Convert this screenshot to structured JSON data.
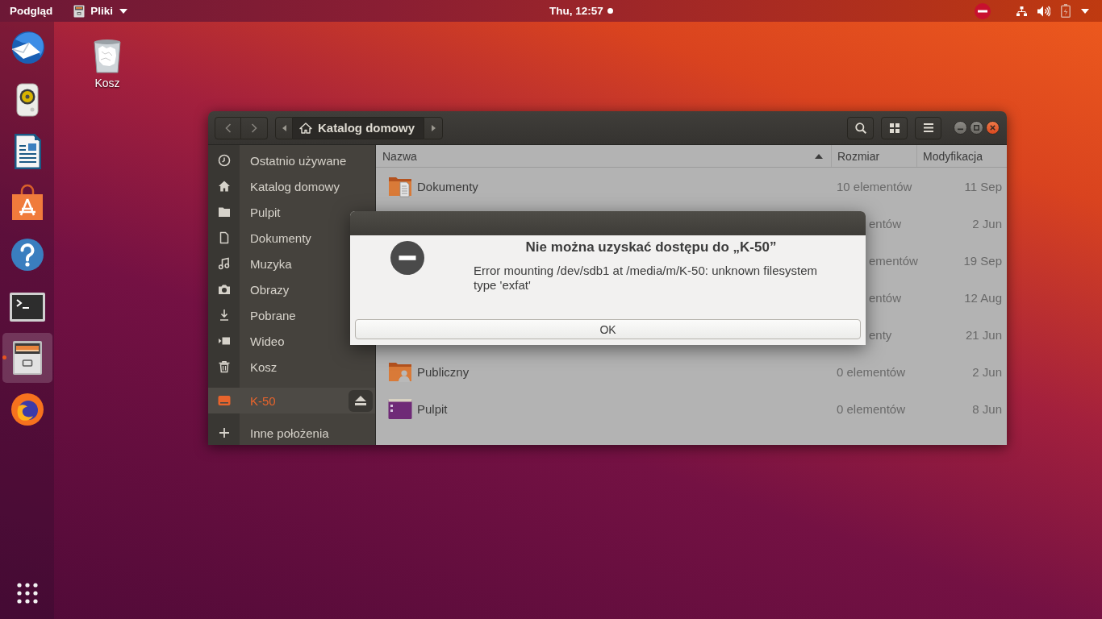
{
  "top_bar": {
    "activities": "Podgląd",
    "app_menu": "Pliki",
    "clock": "Thu, 12:57",
    "unread_notifications": true
  },
  "dock": {
    "items": [
      {
        "kind": "mail",
        "selected": false,
        "running": false
      },
      {
        "kind": "music",
        "selected": false,
        "running": false
      },
      {
        "kind": "writer",
        "selected": false,
        "running": false
      },
      {
        "kind": "software",
        "selected": false,
        "running": false
      },
      {
        "kind": "help",
        "selected": false,
        "running": false
      },
      {
        "kind": "terminal",
        "selected": false,
        "running": false
      },
      {
        "kind": "files",
        "selected": true,
        "running": true
      },
      {
        "kind": "browser",
        "selected": false,
        "running": false
      }
    ]
  },
  "desktop_icons": [
    {
      "kind": "trash",
      "label": "Kosz"
    }
  ],
  "file_manager": {
    "nav": {
      "back": {
        "disabled": true
      },
      "forward": {
        "disabled": true
      }
    },
    "path_bar": {
      "label": "Katalog domowy"
    },
    "sidebar": {
      "places": [
        {
          "kind": "recent",
          "label": "Ostatnio używane",
          "selected": false
        },
        {
          "kind": "home",
          "label": "Katalog domowy",
          "selected": false
        },
        {
          "kind": "desktop",
          "label": "Pulpit",
          "selected": false
        },
        {
          "kind": "documents",
          "label": "Dokumenty",
          "selected": false
        },
        {
          "kind": "music",
          "label": "Muzyka",
          "selected": false
        },
        {
          "kind": "pictures",
          "label": "Obrazy",
          "selected": false
        },
        {
          "kind": "downloads",
          "label": "Pobrane",
          "selected": false
        },
        {
          "kind": "videos",
          "label": "Wideo",
          "selected": false
        },
        {
          "kind": "trash",
          "label": "Kosz",
          "selected": false
        }
      ],
      "devices": [
        {
          "kind": "drive",
          "label": "K-50",
          "selected": true,
          "ejectable": true
        }
      ],
      "other": [
        {
          "kind": "other",
          "label": "Inne położenia",
          "selected": false
        }
      ]
    },
    "table": {
      "columns": [
        {
          "label": "Nazwa",
          "sorted": true
        },
        {
          "label": "Rozmiar",
          "sorted": false
        },
        {
          "label": "Modyfikacja",
          "sorted": false
        }
      ],
      "rows": [
        {
          "kind": "documents",
          "name": "Dokumenty",
          "size": "10 elementów",
          "modified": "11 Sep"
        },
        {
          "size": "entów",
          "modified": "2 Jun"
        },
        {
          "size": "ementów",
          "modified": "19 Sep"
        },
        {
          "size": "entów",
          "modified": "12 Aug"
        },
        {
          "size": "enty",
          "modified": "21 Jun"
        },
        {
          "kind": "public",
          "name": "Publiczny",
          "size": "0 elementów",
          "modified": "2 Jun"
        },
        {
          "kind": "desktop",
          "name": "Pulpit",
          "size": "0 elementów",
          "modified": "8 Jun"
        }
      ]
    }
  },
  "dialog": {
    "title": "Nie można uzyskać dostępu do „K-50”",
    "message": "Error mounting /dev/sdb1 at /media/m/K-50: unknown filesystem type 'exfat'",
    "buttons": [
      "OK"
    ]
  }
}
